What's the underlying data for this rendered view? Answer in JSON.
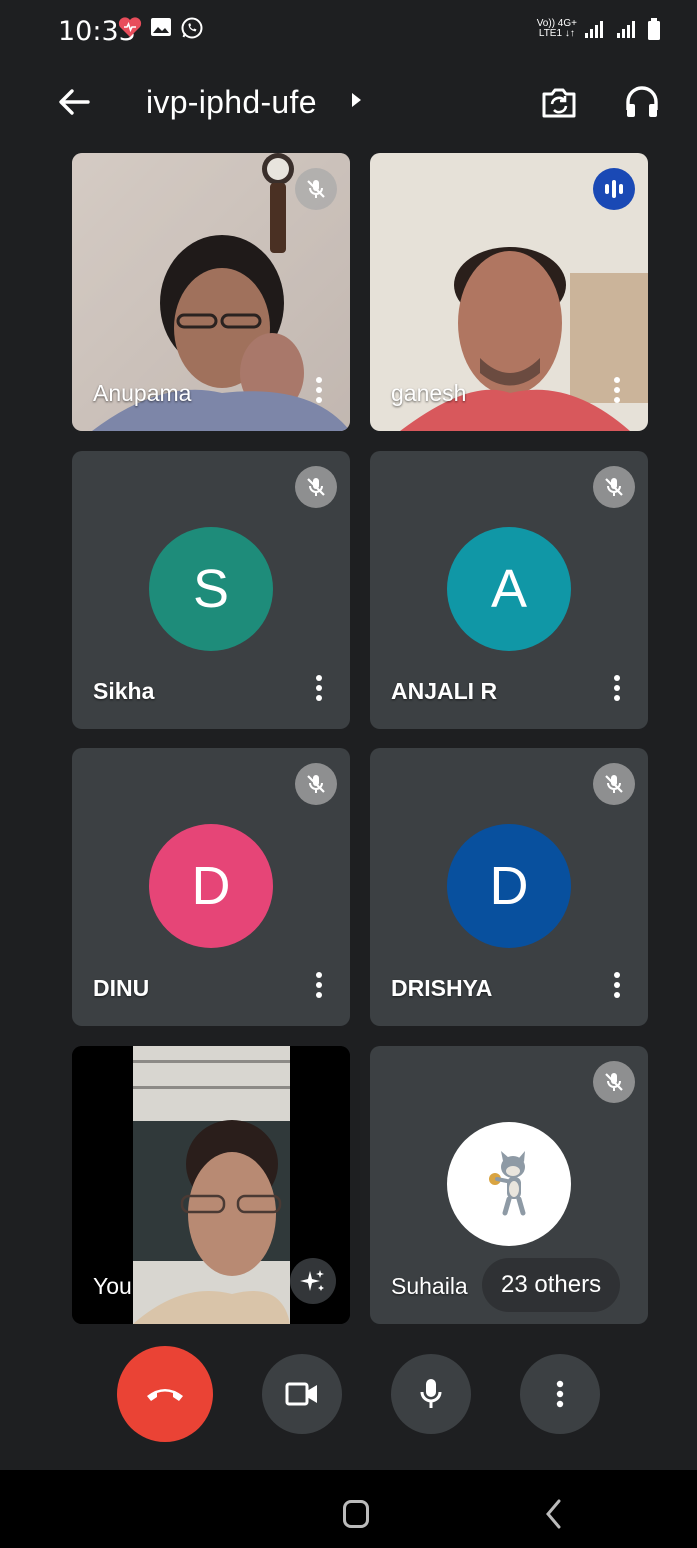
{
  "status_bar": {
    "time": "10:33",
    "left_icons": [
      "heart-icon",
      "image-icon",
      "whatsapp-icon"
    ],
    "network_label_top": "Vo)) 4G+",
    "network_label_bottom": "LTE1 ↓↑"
  },
  "top_bar": {
    "meeting_code": "ivp-iphd-ufe"
  },
  "participants": [
    {
      "name": "Anupama",
      "type": "video",
      "muted": true
    },
    {
      "name": "ganesh",
      "type": "video",
      "speaking": true
    },
    {
      "name": "Sikha",
      "type": "avatar",
      "initial": "S",
      "color": "#1e8c7a",
      "muted": true
    },
    {
      "name": "ANJALI R",
      "type": "avatar",
      "initial": "A",
      "color": "#1097a6",
      "muted": true
    },
    {
      "name": "DINU",
      "type": "avatar",
      "initial": "D",
      "color": "#e64577",
      "muted": true
    },
    {
      "name": "DRISHYA",
      "type": "avatar",
      "initial": "D",
      "color": "#08509e",
      "muted": true
    },
    {
      "name": "You",
      "type": "self-video"
    },
    {
      "name": "Suhaila",
      "type": "avatar-image",
      "muted": true,
      "others_label": "23 others"
    }
  ],
  "controls": {
    "end_call_color": "#ea4335"
  }
}
